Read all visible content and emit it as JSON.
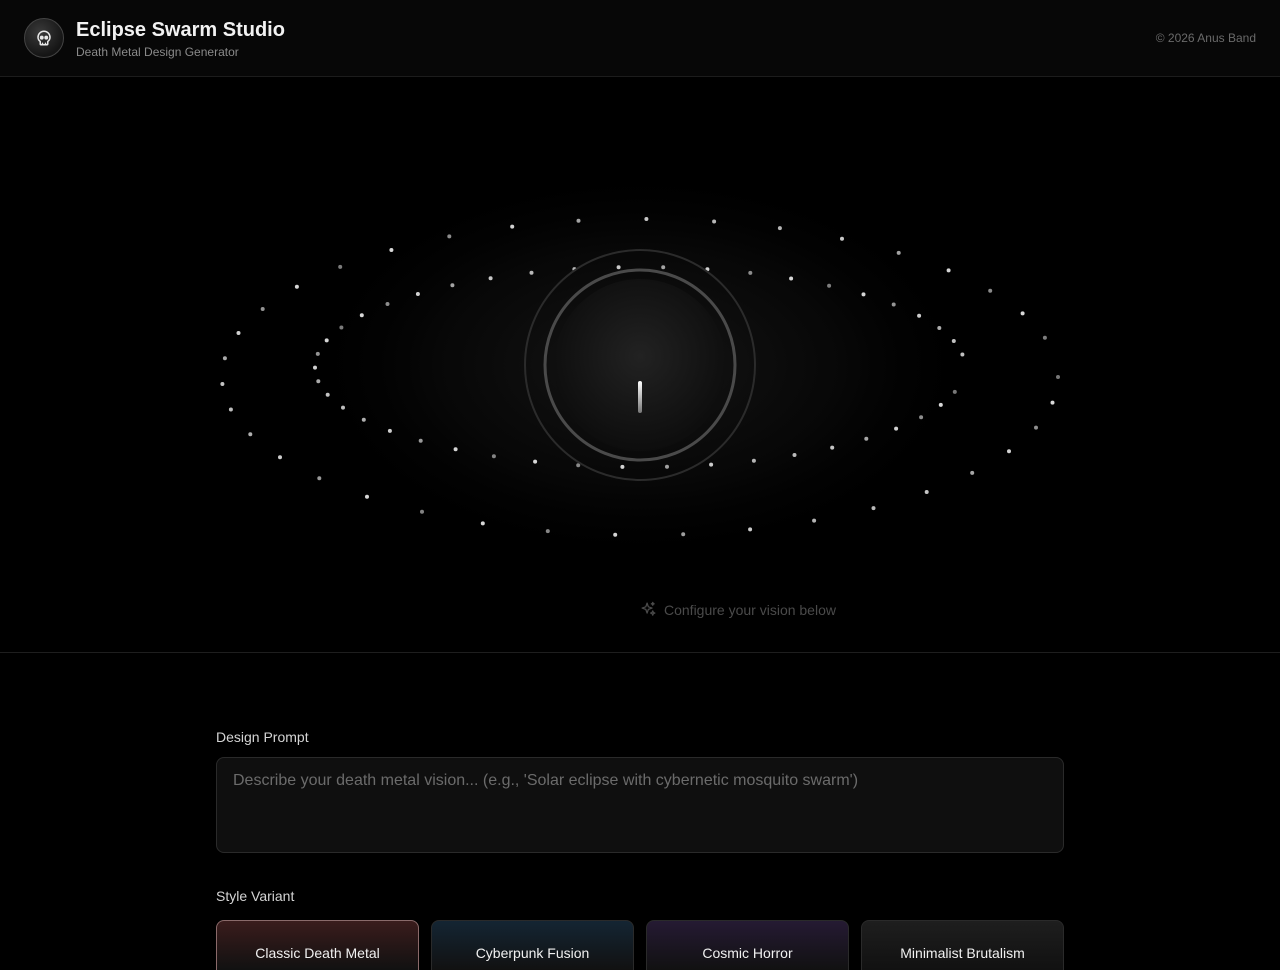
{
  "header": {
    "logo_icon": "skull-icon",
    "title": "Eclipse Swarm Studio",
    "subtitle": "Death Metal Design Generator",
    "copyright": "© 2026 Anus Band"
  },
  "hero": {
    "hint_icon": "sparkles-icon",
    "hint": "Configure your vision below"
  },
  "form": {
    "prompt_label": "Design Prompt",
    "prompt_placeholder": "Describe your death metal vision... (e.g., 'Solar eclipse with cybernetic mosquito swarm')",
    "prompt_value": "",
    "style_label": "Style Variant",
    "styles": [
      {
        "label": "Classic Death Metal",
        "selected": true,
        "color": "#3a1c1c"
      },
      {
        "label": "Cyberpunk Fusion",
        "selected": false,
        "color": "#142533"
      },
      {
        "label": "Cosmic Horror",
        "selected": false,
        "color": "#251a33"
      },
      {
        "label": "Minimalist Brutalism",
        "selected": false,
        "color": "#1e1e1e"
      }
    ]
  }
}
